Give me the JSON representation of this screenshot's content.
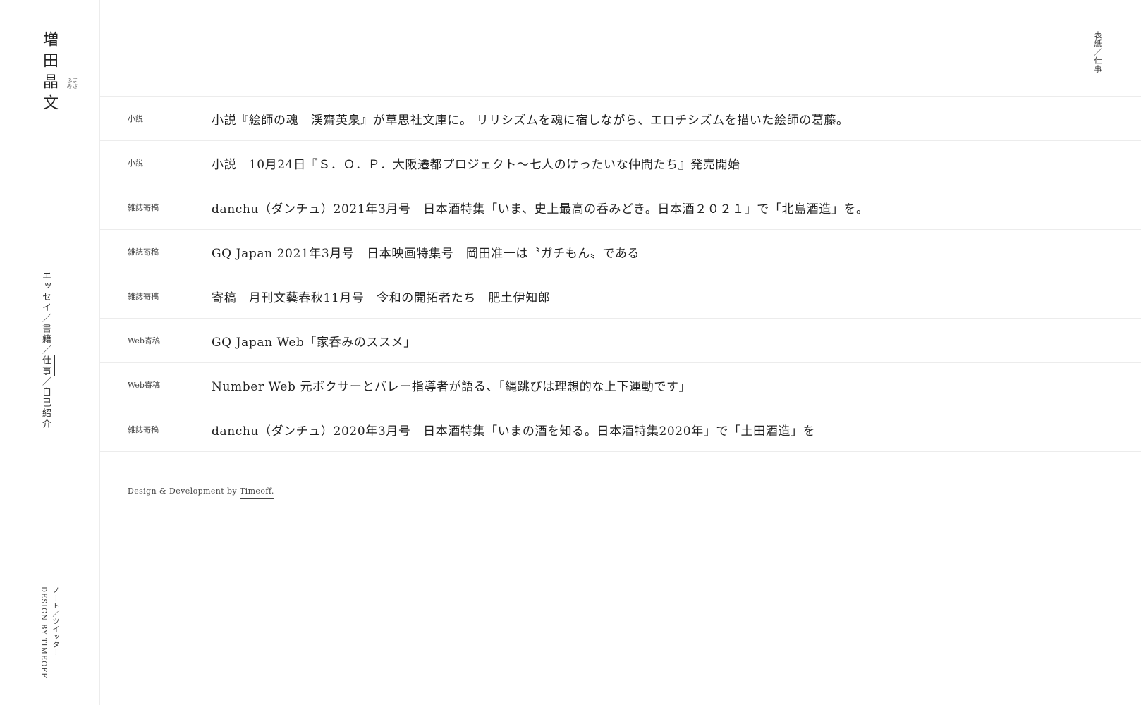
{
  "sidebar": {
    "logo_name": "増田晶文",
    "logo_kana_1": "まさ",
    "logo_kana_2": "ふみ",
    "nav": {
      "essay": "エッセイ",
      "books": "書籍",
      "work": "仕事",
      "profile": "自己紹介",
      "sep": "／"
    },
    "bottom": {
      "note": "ノート",
      "sep": "／",
      "twitter": "ツイッター",
      "design": "DESIGN BY TIMEOFF"
    }
  },
  "header": {
    "breadcrumb": "表紙／仕事"
  },
  "works": [
    {
      "category": "小説",
      "title": "小説『絵師の魂　渓齋英泉』が草思社文庫に。 リリシズムを魂に宿しながら、エロチシズムを描いた絵師の葛藤。"
    },
    {
      "category": "小説",
      "title": "小説　10月24日『Ｓ．Ｏ．Ｐ．大阪遷都プロジェクト〜七人のけったいな仲間たち』発売開始"
    },
    {
      "category": "雑誌寄稿",
      "title": "danchu（ダンチュ）2021年3月号　日本酒特集「いま、史上最高の呑みどき。日本酒２０２１」で「北島酒造」を。"
    },
    {
      "category": "雑誌寄稿",
      "title": "GQ Japan 2021年3月号　日本映画特集号　岡田准一は〝ガチもん〟である"
    },
    {
      "category": "雑誌寄稿",
      "title": "寄稿　月刊文藝春秋11月号　令和の開拓者たち　肥土伊知郎"
    },
    {
      "category": "Web寄稿",
      "title": "GQ Japan Web「家呑みのススメ」"
    },
    {
      "category": "Web寄稿",
      "title": "Number Web 元ボクサーとバレー指導者が語る、「縄跳びは理想的な上下運動です」"
    },
    {
      "category": "雑誌寄稿",
      "title": "danchu（ダンチュ）2020年3月号　日本酒特集「いまの酒を知る。日本酒特集2020年」で「土田酒造」を"
    }
  ],
  "footer": {
    "credit_prefix": "Design & Development by ",
    "credit_link": "Timeoff."
  }
}
